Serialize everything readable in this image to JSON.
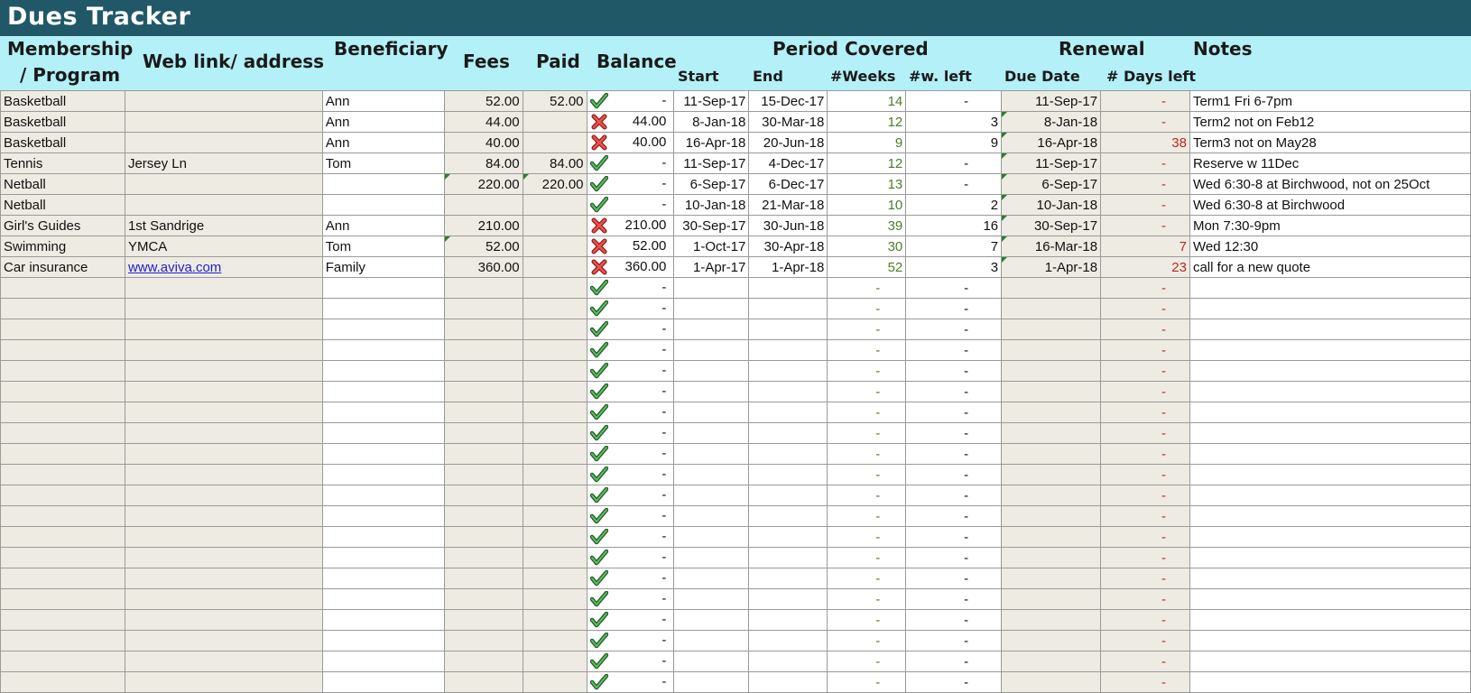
{
  "title": "Dues Tracker",
  "headers": {
    "membership_line1": "Membership",
    "membership_line2": "/ Program",
    "web": "Web  link/ address",
    "beneficiary": "Beneficiary",
    "fees": "Fees",
    "paid": "Paid",
    "balance": "Balance",
    "period": "Period Covered",
    "start": "Start",
    "end": "End",
    "weeks": "#Weeks",
    "wleft": "#w. left",
    "renewal": "Renewal",
    "due": "Due Date",
    "days": "# Days left",
    "notes": "Notes"
  },
  "rows": [
    {
      "program": "Basketball",
      "web": "",
      "beneficiary": "Ann",
      "fees": "52.00",
      "paid": "52.00",
      "status": "check",
      "balance": "-",
      "start": "11-Sep-17",
      "end": "15-Dec-17",
      "weeks": "14",
      "wleft": "-",
      "due": "11-Sep-17",
      "days": "-",
      "notes": "Term1 Fri 6-7pm"
    },
    {
      "program": "Basketball",
      "web": "",
      "beneficiary": "Ann",
      "fees": "44.00",
      "paid": "",
      "status": "cross",
      "balance": "44.00",
      "start": "8-Jan-18",
      "end": "30-Mar-18",
      "weeks": "12",
      "wleft": "3",
      "due": "8-Jan-18",
      "days": "-",
      "notes": "Term2 not on Feb12"
    },
    {
      "program": "Basketball",
      "web": "",
      "beneficiary": "Ann",
      "fees": "40.00",
      "paid": "",
      "status": "cross",
      "balance": "40.00",
      "start": "16-Apr-18",
      "end": "20-Jun-18",
      "weeks": "9",
      "wleft": "9",
      "due": "16-Apr-18",
      "days": "38",
      "notes": "Term3 not on May28"
    },
    {
      "program": "Tennis",
      "web": "Jersey Ln",
      "beneficiary": "Tom",
      "fees": "84.00",
      "paid": "84.00",
      "status": "check",
      "balance": "-",
      "start": "11-Sep-17",
      "end": "4-Dec-17",
      "weeks": "12",
      "wleft": "-",
      "due": "11-Sep-17",
      "days": "-",
      "notes": "Reserve w 11Dec"
    },
    {
      "program": "Netball",
      "web": "",
      "beneficiary": "",
      "fees": "220.00",
      "paid": "220.00",
      "status": "check",
      "balance": "-",
      "start": "6-Sep-17",
      "end": "6-Dec-17",
      "weeks": "13",
      "wleft": "-",
      "due": "6-Sep-17",
      "days": "-",
      "notes": "Wed 6:30-8 at Birchwood, not on 25Oct"
    },
    {
      "program": "Netball",
      "web": "",
      "beneficiary": "",
      "fees": "",
      "paid": "",
      "status": "check",
      "balance": "-",
      "start": "10-Jan-18",
      "end": "21-Mar-18",
      "weeks": "10",
      "wleft": "2",
      "due": "10-Jan-18",
      "days": "-",
      "notes": "Wed 6:30-8 at Birchwood"
    },
    {
      "program": "Girl's Guides",
      "web": "1st Sandrige",
      "beneficiary": "Ann",
      "fees": "210.00",
      "paid": "",
      "status": "cross",
      "balance": "210.00",
      "start": "30-Sep-17",
      "end": "30-Jun-18",
      "weeks": "39",
      "wleft": "16",
      "due": "30-Sep-17",
      "days": "-",
      "notes": "Mon 7:30-9pm"
    },
    {
      "program": "Swimming",
      "web": "YMCA",
      "beneficiary": "Tom",
      "fees": "52.00",
      "paid": "",
      "status": "cross",
      "balance": "52.00",
      "start": "1-Oct-17",
      "end": "30-Apr-18",
      "weeks": "30",
      "wleft": "7",
      "due": "16-Mar-18",
      "days": "7",
      "notes": "Wed 12:30"
    },
    {
      "program": "Car insurance",
      "web": "www.aviva.com",
      "beneficiary": "Family",
      "fees": "360.00",
      "paid": "",
      "status": "cross",
      "balance": "360.00",
      "start": "1-Apr-17",
      "end": "1-Apr-18",
      "weeks": "52",
      "wleft": "3",
      "due": "1-Apr-18",
      "days": "23",
      "notes": "call for a new quote"
    }
  ],
  "empty_row": {
    "status": "check",
    "balance": "-",
    "weeks": "-",
    "wleft": "-",
    "days": "-"
  },
  "colors": {
    "title_bg": "#215868",
    "header_bg": "#b3f0f7",
    "shaded_col": "#eeebe2",
    "check": "#4caf50",
    "cross": "#e53935",
    "weeks_text": "#4e7d25",
    "days_text": "#b52a1e"
  }
}
